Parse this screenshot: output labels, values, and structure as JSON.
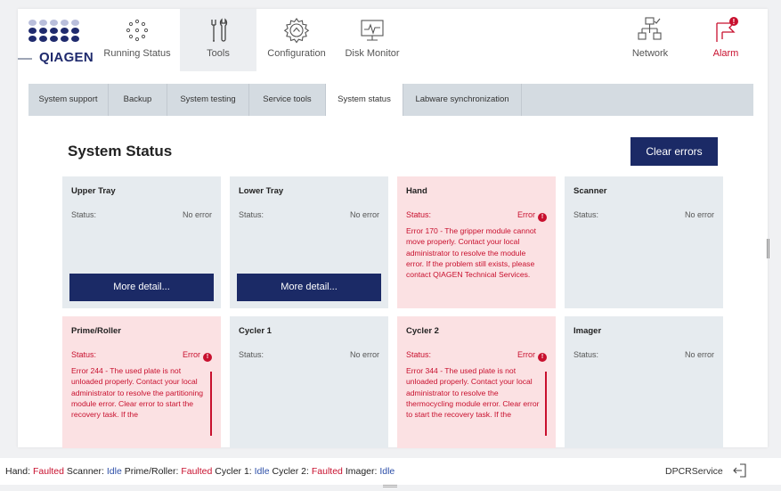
{
  "header": {
    "logo_text": "QIAGEN",
    "nav": [
      {
        "label": "Running Status",
        "icon": "running-status-icon"
      },
      {
        "label": "Tools",
        "icon": "tools-icon"
      },
      {
        "label": "Configuration",
        "icon": "gear-icon"
      },
      {
        "label": "Disk Monitor",
        "icon": "disk-monitor-icon"
      },
      {
        "label": "Network",
        "icon": "network-icon"
      },
      {
        "label": "Alarm",
        "icon": "alarm-flag-icon"
      }
    ],
    "alarm_count": "!"
  },
  "tabs": [
    "System support",
    "Backup",
    "System testing",
    "Service tools",
    "System status",
    "Labware synchronization"
  ],
  "active_tab": "System status",
  "main": {
    "title": "System Status",
    "clear_button": "Clear errors",
    "status_label": "Status:",
    "more_detail": "More detail...",
    "cards": [
      {
        "name": "Upper Tray",
        "status": "No error",
        "message": ""
      },
      {
        "name": "Lower Tray",
        "status": "No error",
        "message": ""
      },
      {
        "name": "Hand",
        "status": "Error",
        "message": "Error 170 - The gripper module cannot move properly. Contact your local administrator to resolve the module error. If the problem still exists, please contact QIAGEN Technical Services."
      },
      {
        "name": "Scanner",
        "status": "No error",
        "message": ""
      },
      {
        "name": "Prime/Roller",
        "status": "Error",
        "message": "Error 244 - The used plate is not unloaded properly. Contact your local administrator to resolve the partitioning module error. Clear error to start the recovery task. If the"
      },
      {
        "name": "Cycler 1",
        "status": "No error",
        "message": ""
      },
      {
        "name": "Cycler 2",
        "status": "Error",
        "message": "Error 344 - The used plate is not unloaded properly. Contact your local administrator to resolve the thermocycling module error. Clear error to start the recovery task. If the"
      },
      {
        "name": "Imager",
        "status": "No error",
        "message": ""
      }
    ]
  },
  "footer": {
    "states": [
      {
        "key": "Hand:",
        "value": "Faulted"
      },
      {
        "key": "Scanner:",
        "value": "Idle"
      },
      {
        "key": "Prime/Roller:",
        "value": "Faulted"
      },
      {
        "key": "Cycler 1:",
        "value": "Idle"
      },
      {
        "key": "Cycler 2:",
        "value": "Faulted"
      },
      {
        "key": "Imager:",
        "value": "Idle"
      }
    ],
    "user": "DPCRService"
  },
  "colors": {
    "accent": "#1b2a66",
    "error": "#c8102e",
    "idle": "#2d4fa8",
    "card_ok": "#e6ebef",
    "card_error": "#fbe1e3"
  }
}
